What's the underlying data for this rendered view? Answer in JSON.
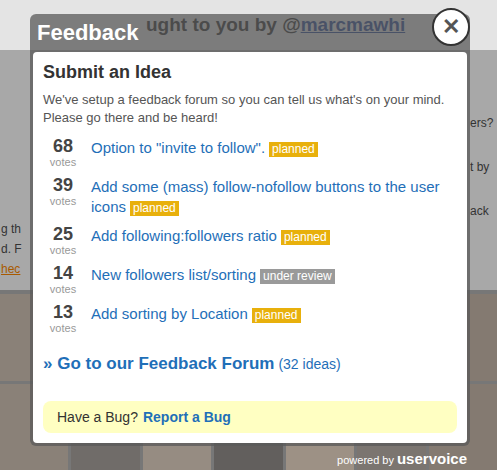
{
  "background": {
    "heading_prefix": "ught to you by @",
    "heading_link": "marcmawhi",
    "left_fragments": [
      "g th",
      "d. F",
      "hec"
    ],
    "right_fragments": [
      "ers?",
      "t by",
      "ack"
    ]
  },
  "dialog": {
    "title": "Feedback",
    "close": "✕"
  },
  "panel": {
    "title": "Submit an Idea",
    "intro": "We've setup a feedback forum so you can tell us what's on your mind. Please go there and be heard!",
    "ideas": [
      {
        "votes": "68",
        "votes_label": "votes",
        "title": "Option to \"invite to follow\".",
        "status": "planned",
        "color": "#e8b00c"
      },
      {
        "votes": "39",
        "votes_label": "votes",
        "title": "Add some (mass) follow-nofollow buttons to the user icons",
        "status": "planned",
        "color": "#e8b00c"
      },
      {
        "votes": "25",
        "votes_label": "votes",
        "title": "Add following:followers ratio",
        "status": "planned",
        "color": "#e8b00c"
      },
      {
        "votes": "14",
        "votes_label": "votes",
        "title": "New followers list/sorting",
        "status": "under review",
        "color": "#9a9a9a"
      },
      {
        "votes": "13",
        "votes_label": "votes",
        "title": "Add sorting by Location",
        "status": "planned",
        "color": "#e8b00c"
      }
    ],
    "forum_link": "» Go to our Feedback Forum",
    "forum_count": "(32 ideas)",
    "bug": {
      "prompt": "Have a Bug?",
      "link": "Report a Bug"
    }
  },
  "footer": {
    "powered_by": "powered by",
    "brand": "uservoice"
  }
}
